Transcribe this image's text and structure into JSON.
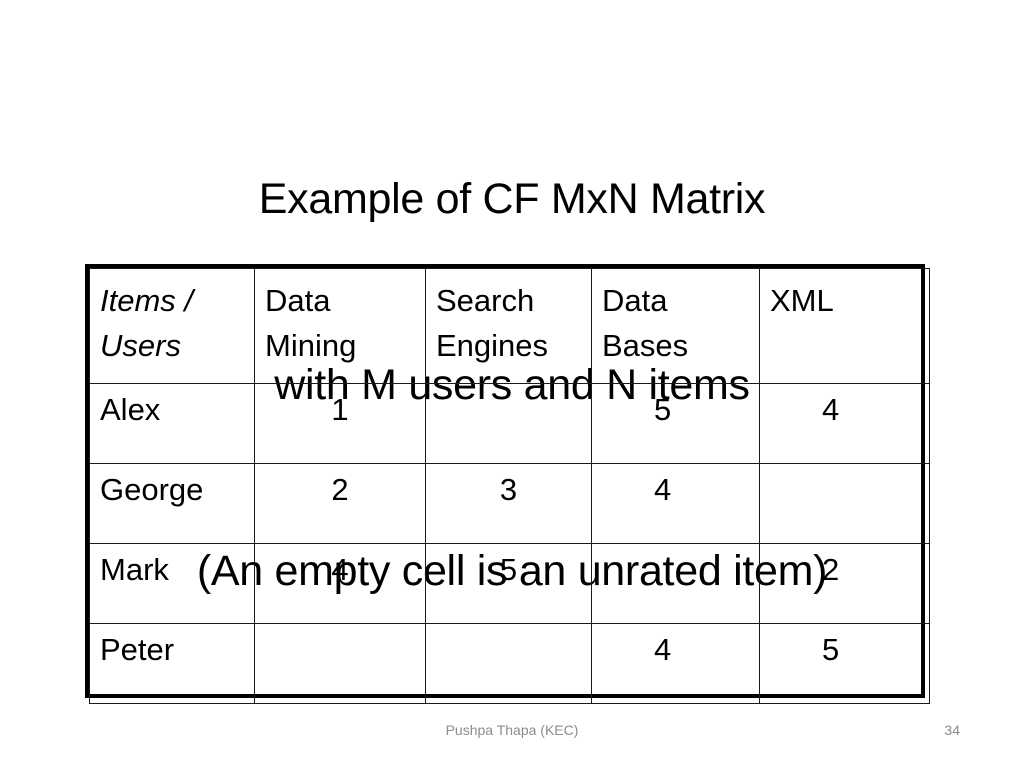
{
  "slide": {
    "title_lines": [
      "Example of CF MxN Matrix",
      "with M users and N items",
      "(An empty cell is an unrated item)"
    ],
    "title_full": "Example of CF MxN Matrix\nwith M users and N items\n(An empty cell is an unrated item)"
  },
  "matrix": {
    "corner_header": "Items /\nUsers",
    "columns": [
      {
        "label": "Data\nMining",
        "align": "center"
      },
      {
        "label": "Search\nEngines",
        "align": "center"
      },
      {
        "label": "Data\nBases",
        "align": "off-center"
      },
      {
        "label": "XML",
        "align": "off-center"
      }
    ],
    "rows": [
      {
        "user": "Alex",
        "ratings": [
          "1",
          "",
          "5",
          "4"
        ]
      },
      {
        "user": "George",
        "ratings": [
          "2",
          "3",
          "4",
          ""
        ]
      },
      {
        "user": "Mark",
        "ratings": [
          "4",
          "5",
          "",
          "2"
        ]
      },
      {
        "user": "Peter",
        "ratings": [
          "",
          "",
          "4",
          "5"
        ]
      }
    ]
  },
  "footer": {
    "author": "Pushpa Thapa (KEC)",
    "page_number": "34"
  },
  "colors": {
    "text": "#000000",
    "background": "#ffffff",
    "table_outer_border": "#000000",
    "table_inner_border": "#1a1a1a",
    "footer_text": "#8c8c8c"
  }
}
